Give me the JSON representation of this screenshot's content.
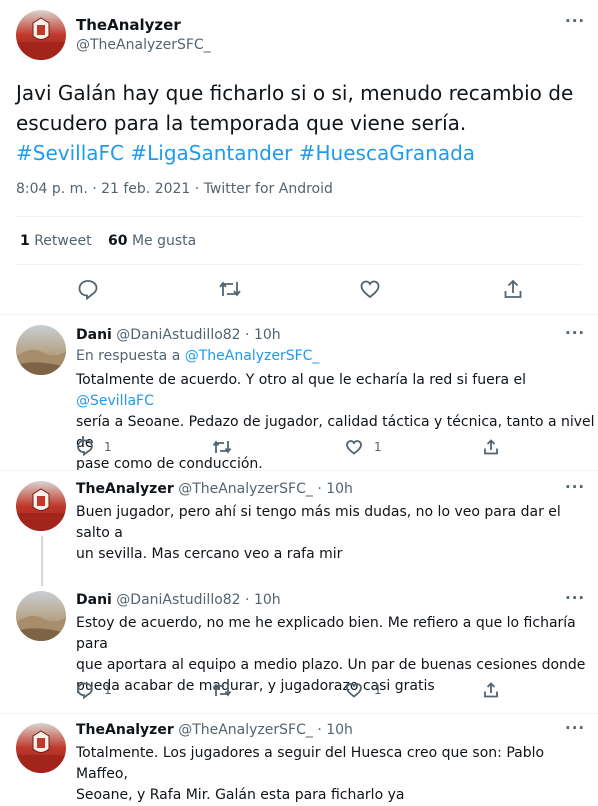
{
  "main_tweet": {
    "name": "TheAnalyzer",
    "handle": "@TheAnalyzerSFC_",
    "text_line1": "Javi Galán hay que ficharlo si o si, menudo recambio de",
    "text_line2": "escudero para la temporada que viene sería.",
    "hashtags": [
      "#SevillaFC",
      "#LigaSantander",
      "#HuescaGranada"
    ],
    "meta": "8:04 p. m. · 21 feb. 2021 · Twitter for Android",
    "retweet_count": "1",
    "retweet_label": "Retweet",
    "like_count": "60",
    "like_label": "Me gusta",
    "more": "···"
  },
  "replies": [
    {
      "name": "Dani",
      "handle": "@DaniAstudillo82",
      "time": "· 10h",
      "reply_prefix": "En respuesta a",
      "reply_to": "@TheAnalyzerSFC_",
      "text_line1a": "Totalmente de acuerdo. Y otro al que le echaría la red si fuera el",
      "mention": "@SevillaFC",
      "text_line2": "sería a Seoane. Pedazo de jugador, calidad táctica y técnica, tanto a nivel de",
      "text_line3": "pase como de conducción.",
      "reply_count": "1",
      "like_count": "1",
      "more": "···"
    },
    {
      "name": "TheAnalyzer",
      "handle": "@TheAnalyzerSFC_",
      "time": "· 10h",
      "text_line1": "Buen jugador, pero ahí si tengo más mis dudas, no lo veo para dar el salto a",
      "text_line2": "un sevilla. Mas cercano veo a rafa mir",
      "more": "···"
    },
    {
      "name": "Dani",
      "handle": "@DaniAstudillo82",
      "time": "· 10h",
      "text_line1": "Estoy de acuerdo, no me he explicado bien. Me refiero a que lo ficharía para",
      "text_line2": "que aportara al equipo a medio plazo. Un par de buenas cesiones donde",
      "text_line3": "pueda acabar de madurar, y jugadorazo casi gratis",
      "reply_count": "1",
      "like_count": "1",
      "more": "···"
    },
    {
      "name": "TheAnalyzer",
      "handle": "@TheAnalyzerSFC_",
      "time": "· 10h",
      "text_line1": "Totalmente. Los jugadores a seguir del Huesca creo que son: Pablo Maffeo,",
      "text_line2": "Seoane, y Rafa Mir. Galán esta para ficharlo ya",
      "more": "···"
    }
  ]
}
